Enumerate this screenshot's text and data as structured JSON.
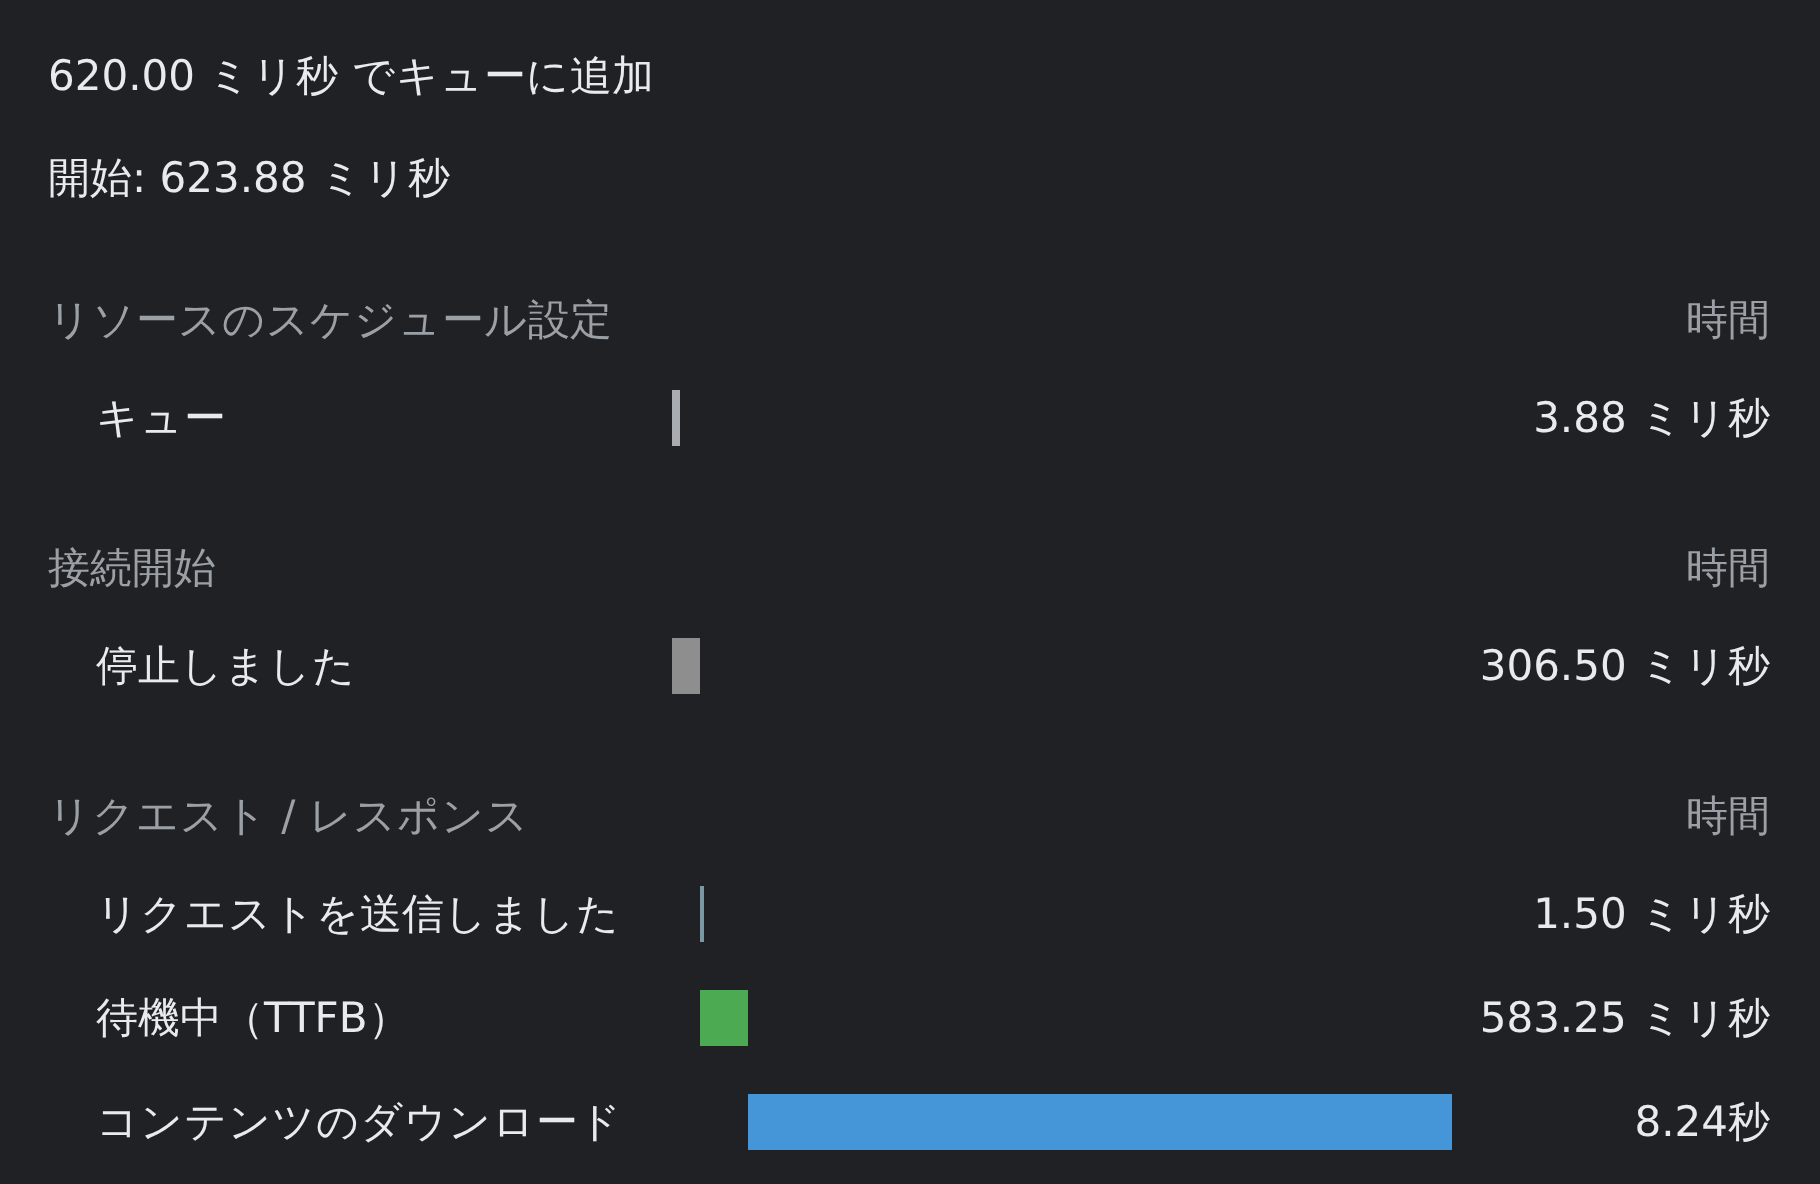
{
  "summary": [
    "620.00 ミリ秒 でキューに追加",
    "開始: 623.88 ミリ秒"
  ],
  "sections": [
    {
      "title": "リソースのスケジュール設定",
      "column": "時間",
      "rows": [
        {
          "label": "キュー",
          "color": "#a9adb2",
          "time": "3.88 ミリ秒"
        }
      ]
    },
    {
      "title": "接続開始",
      "column": "時間",
      "rows": [
        {
          "label": "停止しました",
          "color": "#8e8e8e",
          "time": "306.50 ミリ秒"
        }
      ]
    },
    {
      "title": "リクエスト / レスポンス",
      "column": "時間",
      "rows": [
        {
          "label": "リクエストを送信しました",
          "color": "#7a97a3",
          "time": "1.50 ミリ秒"
        },
        {
          "label": "待機中（TTFB）",
          "color": "#4caa52",
          "time": "583.25 ミリ秒"
        },
        {
          "label": "コンテンツのダウンロード",
          "color": "#4496d9",
          "time": "8.24秒"
        }
      ]
    }
  ]
}
